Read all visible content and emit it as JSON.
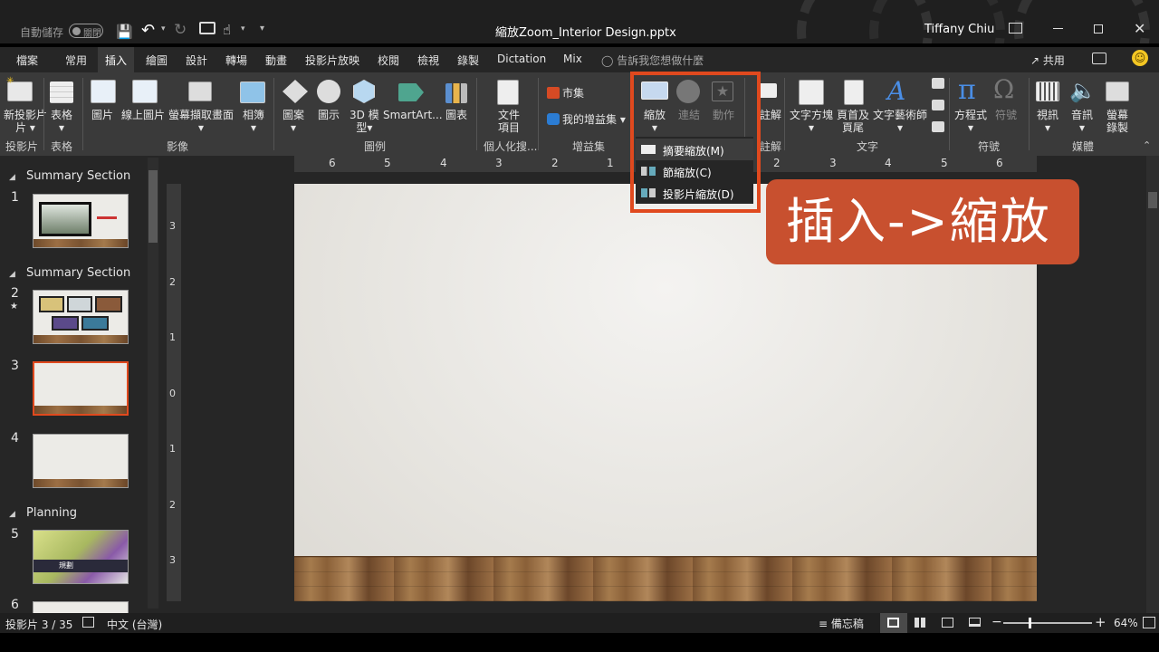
{
  "titlebar": {
    "autosave_label": "自動儲存",
    "autosave_state": "關閉",
    "file_name": "縮放Zoom_Interior Design.pptx",
    "user_name": "Tiffany Chiu"
  },
  "tabs": [
    "檔案",
    "常用",
    "插入",
    "繪圖",
    "設計",
    "轉場",
    "動畫",
    "投影片放映",
    "校閱",
    "檢視",
    "錄製",
    "Dictation",
    "Mix"
  ],
  "active_tab": "插入",
  "tell_me": "告訴我您想做什麼",
  "share_label": "共用",
  "ribbon": {
    "new_slide": "新投影片",
    "new_slide_2": "片",
    "table": "表格",
    "picture": "圖片",
    "online_picture": "線上圖片",
    "screenshot": "螢幕擷取畫面",
    "album": "相簿",
    "shapes": "圖案",
    "icons": "圖示",
    "model_3d": "3D 模",
    "model_3d_2": "型",
    "smartart": "SmartArt...",
    "chart": "圖表",
    "document_item": "文件",
    "document_item_2": "項目",
    "store": "市集",
    "my_addins": "我的增益集",
    "zoom": "縮放",
    "link": "連結",
    "action": "動作",
    "comment_partial": "註解",
    "textbox": "文字方塊",
    "header_footer": "頁首及",
    "header_footer_2": "頁尾",
    "wordart": "文字藝術師",
    "equation": "方程式",
    "symbol": "符號",
    "video": "視訊",
    "audio": "音訊",
    "screen_recording": "螢幕",
    "screen_recording_2": "錄製",
    "groups": {
      "slides": "投影片",
      "tables": "表格",
      "images": "影像",
      "illustrations": "圖例",
      "personalize": "個人化搜...",
      "addins": "增益集",
      "comments": "註解",
      "text": "文字",
      "symbols": "符號",
      "media": "媒體"
    }
  },
  "zoom_menu": [
    "摘要縮放(M)",
    "節縮放(C)",
    "投影片縮放(D)"
  ],
  "callout": "插入->縮放",
  "slide_panel": {
    "sections": [
      "Summary Section",
      "Summary Section",
      "Planning"
    ],
    "slide_numbers": [
      "1",
      "2",
      "3",
      "4",
      "5",
      "6"
    ],
    "star_mark": "★",
    "slide5_title": "規劃"
  },
  "ruler_h": [
    "6",
    "5",
    "4",
    "3",
    "2",
    "1",
    "2",
    "3",
    "4",
    "5",
    "6"
  ],
  "ruler_v": [
    "3",
    "2",
    "1",
    "0",
    "1",
    "2",
    "3"
  ],
  "status": {
    "slide_count": "投影片 3 / 35",
    "language": "中文 (台灣)",
    "notes": "備忘稿",
    "zoom_percent": "64%"
  },
  "colors": {
    "accent": "#e0491e",
    "callout_bg": "#c8502f",
    "ribbon_bg": "#3a3a3a",
    "titlebar_bg": "#1f1f1f"
  }
}
